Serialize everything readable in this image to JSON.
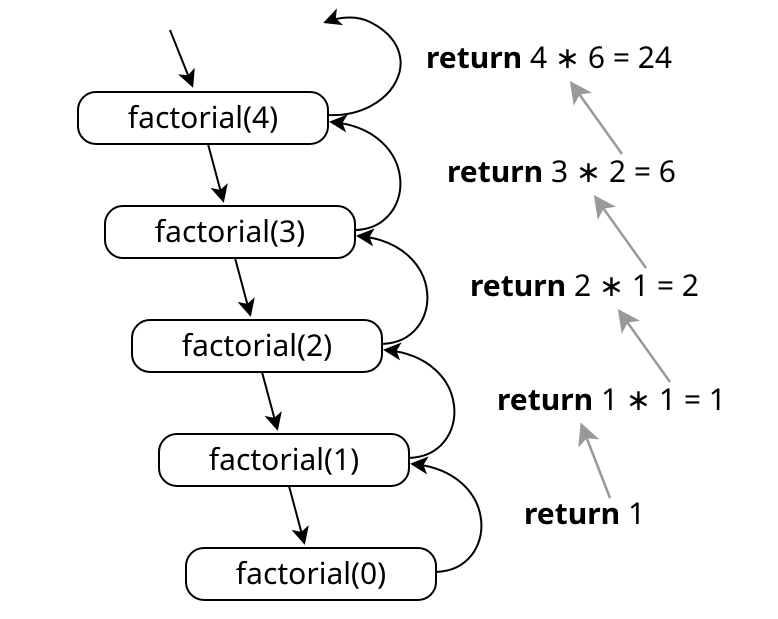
{
  "nodes": [
    {
      "label": "factorial(4)"
    },
    {
      "label": "factorial(3)"
    },
    {
      "label": "factorial(2)"
    },
    {
      "label": "factorial(1)"
    },
    {
      "label": "factorial(0)"
    }
  ],
  "returns": [
    {
      "keyword": "return",
      "expr": " 4 ∗ 6 = 24"
    },
    {
      "keyword": "return",
      "expr": " 3 ∗ 2 = 6"
    },
    {
      "keyword": "return",
      "expr": " 2 ∗ 1 = 2"
    },
    {
      "keyword": "return",
      "expr": " 1 ∗ 1 = 1"
    },
    {
      "keyword": "return",
      "expr": " 1"
    }
  ]
}
